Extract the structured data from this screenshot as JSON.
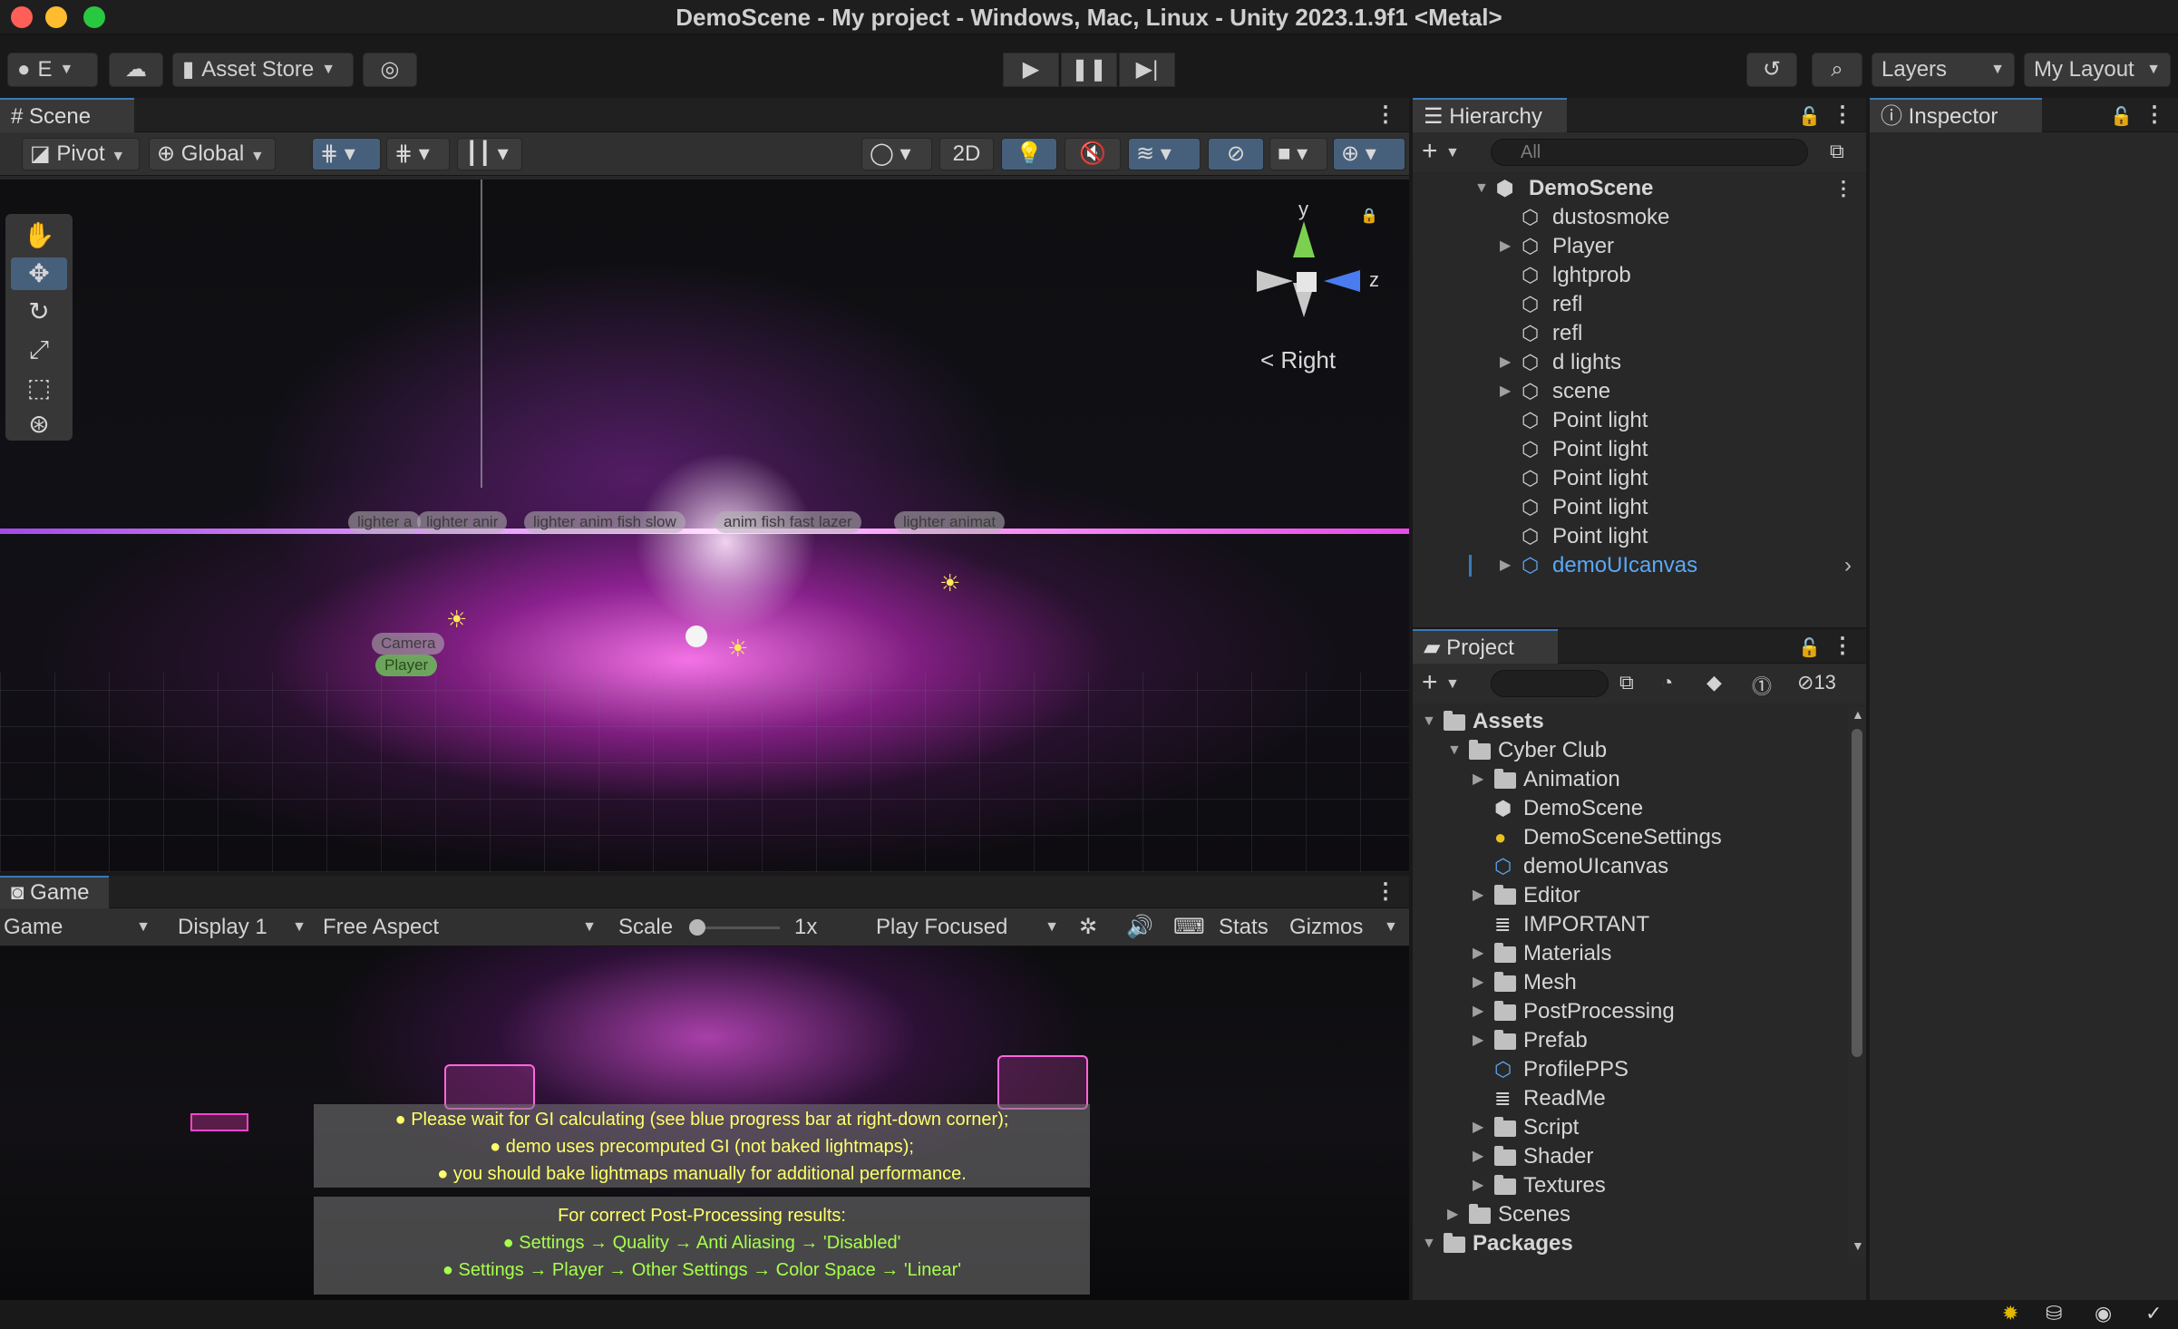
{
  "window": {
    "title": "DemoScene - My project - Windows, Mac, Linux - Unity 2023.1.9f1 <Metal>"
  },
  "toolbar": {
    "account": "E",
    "asset_store": "Asset Store",
    "layers": "Layers",
    "layout": "My Layout"
  },
  "scene": {
    "tab": "Scene",
    "pivot": "Pivot",
    "global": "Global",
    "mode_2d": "2D",
    "gizmo_axes": {
      "y": "y",
      "z": "z"
    },
    "view_label": "Right",
    "labels": [
      "lighter a",
      "lighter anir",
      "lighter anim fish slow",
      "anim fish fast lazer",
      "lighter animat",
      "Camera",
      "Player"
    ]
  },
  "game": {
    "tab": "Game",
    "mode": "Game",
    "display": "Display 1",
    "aspect": "Free Aspect",
    "scale_label": "Scale",
    "scale_value": "1x",
    "play_focused": "Play Focused",
    "stats": "Stats",
    "gizmos": "Gizmos",
    "note1": [
      "● Please wait for GI calculating (see blue progress bar at right-down corner);",
      "● demo uses precomputed GI (not baked lightmaps);",
      "● you should bake lightmaps manually for additional performance."
    ],
    "note2_title": "For correct Post-Processing results:",
    "note2": [
      "● Settings → Quality → Anti Aliasing → 'Disabled'",
      "● Settings → Player → Other Settings → Color Space → 'Linear'"
    ]
  },
  "hierarchy": {
    "tab": "Hierarchy",
    "search_placeholder": "All",
    "root": "DemoScene",
    "items": [
      {
        "label": "dustosmoke",
        "expandable": false
      },
      {
        "label": "Player",
        "expandable": true
      },
      {
        "label": "lghtprob",
        "expandable": false
      },
      {
        "label": "refl",
        "expandable": false
      },
      {
        "label": "refl",
        "expandable": false
      },
      {
        "label": "d lights",
        "expandable": true
      },
      {
        "label": "scene",
        "expandable": true
      },
      {
        "label": "Point light",
        "expandable": false
      },
      {
        "label": "Point light",
        "expandable": false
      },
      {
        "label": "Point light",
        "expandable": false
      },
      {
        "label": "Point light",
        "expandable": false
      },
      {
        "label": "Point light",
        "expandable": false
      },
      {
        "label": "demoUIcanvas",
        "expandable": true,
        "highlight": true
      }
    ]
  },
  "inspector": {
    "tab": "Inspector"
  },
  "project": {
    "tab": "Project",
    "hidden_count": "13",
    "tree": [
      {
        "label": "Assets",
        "level": 0,
        "type": "folder",
        "arrow": "open",
        "bold": true
      },
      {
        "label": "Cyber Club",
        "level": 1,
        "type": "folder",
        "arrow": "open"
      },
      {
        "label": "Animation",
        "level": 2,
        "type": "folder",
        "arrow": "closed"
      },
      {
        "label": "DemoScene",
        "level": 2,
        "type": "scene"
      },
      {
        "label": "DemoSceneSettings",
        "level": 2,
        "type": "settings"
      },
      {
        "label": "demoUIcanvas",
        "level": 2,
        "type": "prefab"
      },
      {
        "label": "Editor",
        "level": 2,
        "type": "folder",
        "arrow": "closed"
      },
      {
        "label": "IMPORTANT",
        "level": 2,
        "type": "doc"
      },
      {
        "label": "Materials",
        "level": 2,
        "type": "folder",
        "arrow": "closed"
      },
      {
        "label": "Mesh",
        "level": 2,
        "type": "folder",
        "arrow": "closed"
      },
      {
        "label": "PostProcessing",
        "level": 2,
        "type": "folder",
        "arrow": "closed"
      },
      {
        "label": "Prefab",
        "level": 2,
        "type": "folder",
        "arrow": "closed"
      },
      {
        "label": "ProfilePPS",
        "level": 2,
        "type": "profile"
      },
      {
        "label": "ReadMe",
        "level": 2,
        "type": "doc"
      },
      {
        "label": "Script",
        "level": 2,
        "type": "folder",
        "arrow": "closed"
      },
      {
        "label": "Shader",
        "level": 2,
        "type": "folder",
        "arrow": "closed"
      },
      {
        "label": "Textures",
        "level": 2,
        "type": "folder",
        "arrow": "closed"
      },
      {
        "label": "Scenes",
        "level": 1,
        "type": "folder",
        "arrow": "closed"
      },
      {
        "label": "Packages",
        "level": 0,
        "type": "folder",
        "arrow": "open",
        "bold": true
      }
    ]
  },
  "colors": {
    "accent": "#3a79bb",
    "selection": "#46607c",
    "link_blue": "#5aa8f5"
  }
}
